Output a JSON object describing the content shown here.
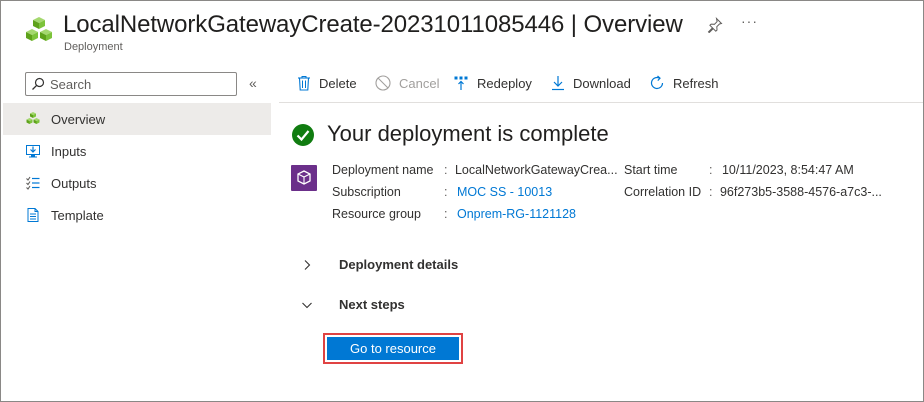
{
  "header": {
    "title": "LocalNetworkGatewayCreate-20231011085446 | Overview",
    "subtitle": "Deployment",
    "more": "···"
  },
  "leftnav": {
    "search_placeholder": "Search",
    "collapse": "«",
    "items": [
      {
        "label": "Overview",
        "icon": "cubes-icon",
        "active": true
      },
      {
        "label": "Inputs",
        "icon": "monitor-download-icon",
        "active": false
      },
      {
        "label": "Outputs",
        "icon": "list-check-icon",
        "active": false
      },
      {
        "label": "Template",
        "icon": "document-icon",
        "active": false
      }
    ]
  },
  "toolbar": {
    "delete": "Delete",
    "cancel": "Cancel",
    "redeploy": "Redeploy",
    "download": "Download",
    "refresh": "Refresh"
  },
  "main": {
    "status": "Your deployment is complete",
    "details": {
      "deployment_name_label": "Deployment name",
      "deployment_name_value": "LocalNetworkGatewayCrea...",
      "subscription_label": "Subscription",
      "subscription_value": "MOC SS - 10013",
      "resource_group_label": "Resource group",
      "resource_group_value": "Onprem-RG-1121128",
      "start_time_label": "Start time",
      "start_time_value": "10/11/2023, 8:54:47 AM",
      "correlation_id_label": "Correlation ID",
      "correlation_id_value": "96f273b5-3588-4576-a7c3-..."
    },
    "sections": {
      "deployment_details": "Deployment details",
      "next_steps": "Next steps"
    },
    "go_to_resource": "Go to resource"
  },
  "colors": {
    "accent": "#0078d4",
    "success": "#107c10",
    "highlight_border": "#e04343",
    "resource_icon": "#6b2f8a"
  }
}
